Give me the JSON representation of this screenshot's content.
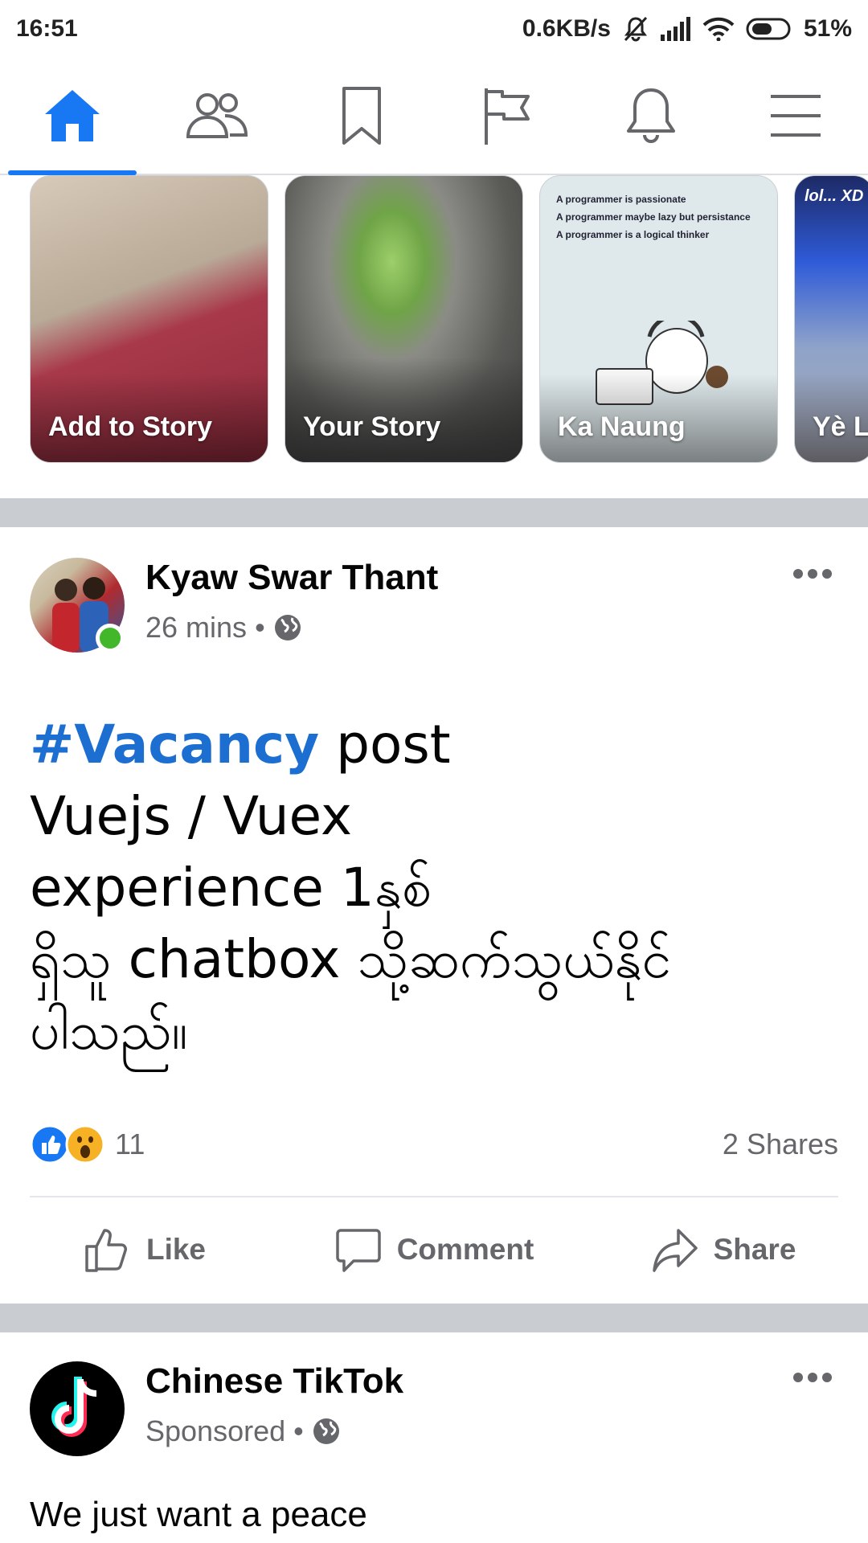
{
  "status_bar": {
    "time": "16:51",
    "speed": "0.6KB/s",
    "battery": "51%"
  },
  "nav": {
    "items": [
      {
        "name": "home",
        "icon": "home-icon",
        "active": true
      },
      {
        "name": "friends",
        "icon": "friends-icon",
        "active": false
      },
      {
        "name": "saved",
        "icon": "bookmark-icon",
        "active": false
      },
      {
        "name": "pages",
        "icon": "flag-icon",
        "active": false
      },
      {
        "name": "notifications",
        "icon": "bell-icon",
        "active": false
      },
      {
        "name": "menu",
        "icon": "hamburger-menu-icon",
        "active": false
      }
    ],
    "accent_color": "#1877f2"
  },
  "stories": [
    {
      "label": "Add to Story"
    },
    {
      "label": "Your Story"
    },
    {
      "label": "Ka Naung",
      "image_text": [
        "A programmer is passionate",
        "A programmer maybe lazy but persistance",
        "A programmer is a logical thinker"
      ]
    },
    {
      "label": "Yè L",
      "image_text": "lol... XD"
    }
  ],
  "post1": {
    "author": "Kyaw Swar Thant",
    "time": "26 mins",
    "separator": "•",
    "audience_icon": "globe-icon",
    "hashtag": "#Vacancy",
    "text_after_hashtag": " post",
    "body_lines": [
      "Vuejs / Vuex",
      "experience 1နှစ်",
      "ရှိသူ chatbox သို့ဆက်သွယ်နိုင်",
      "ပါသည်။"
    ],
    "reaction_count": "11",
    "shares": "2 Shares",
    "actions": {
      "like": "Like",
      "comment": "Comment",
      "share": "Share"
    }
  },
  "post2": {
    "author": "Chinese TikTok",
    "meta": "Sponsored",
    "separator": "•",
    "text": "We just want a peace"
  }
}
